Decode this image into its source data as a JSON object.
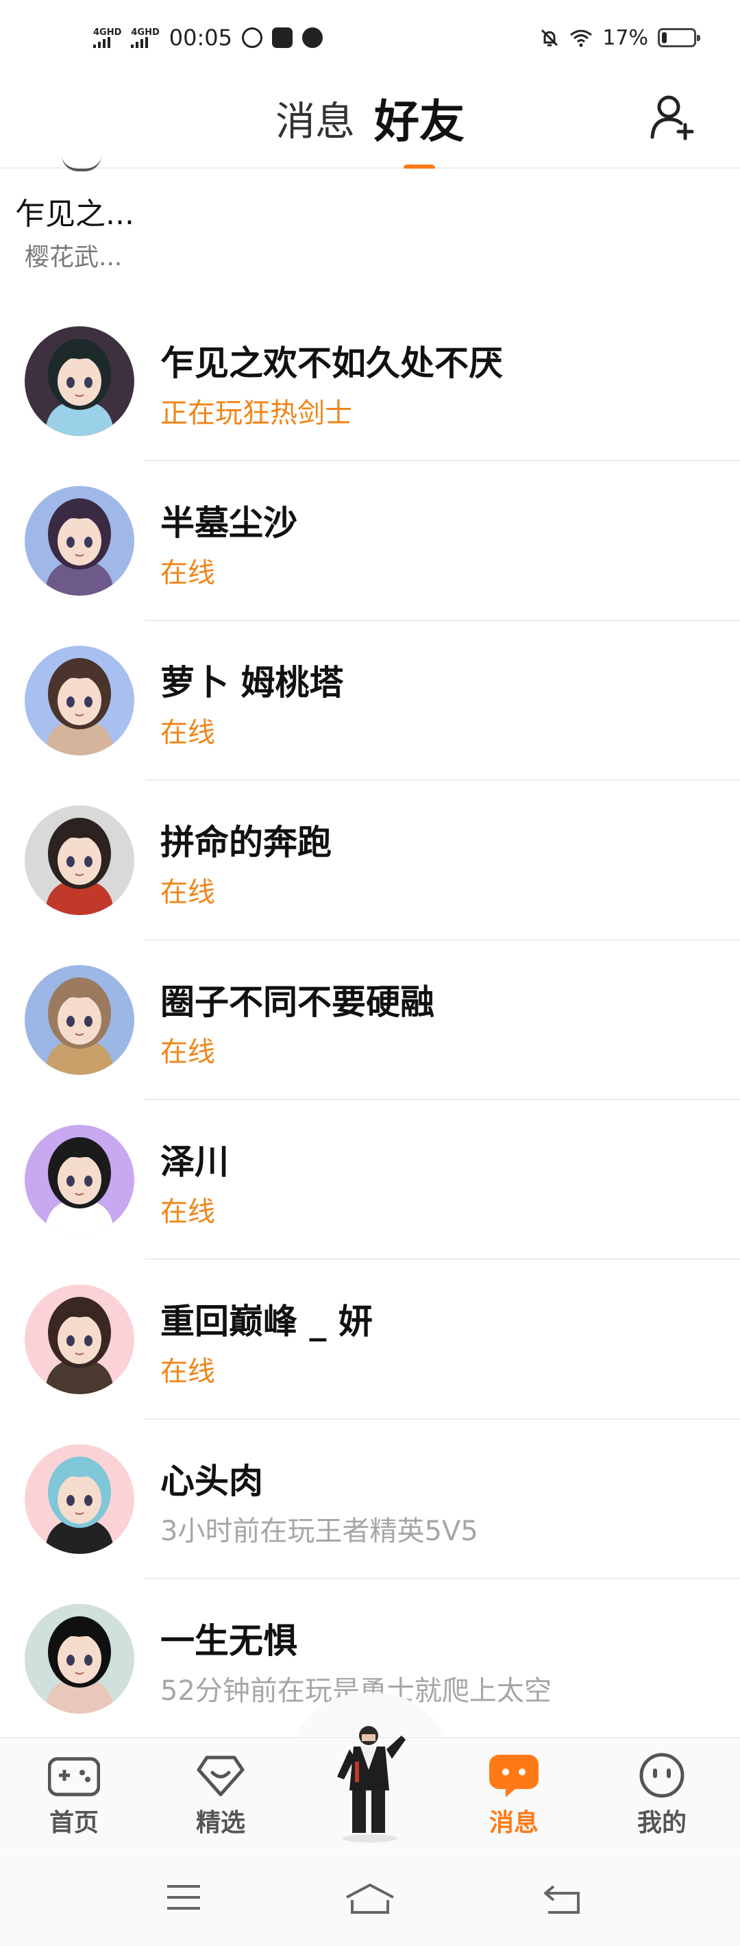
{
  "status_bar": {
    "signal1": "4GHD",
    "signal2": "4GHD",
    "time": "00:05",
    "battery": "17%",
    "battery_level": 0.17
  },
  "header": {
    "tabs": [
      {
        "label": "消息",
        "active": false
      },
      {
        "label": "好友",
        "active": true
      }
    ]
  },
  "pinned": {
    "name": "乍见之...",
    "sub": "樱花武..."
  },
  "friends": [
    {
      "name": "乍见之欢不如久处不厌",
      "status": "正在玩狂热剑士",
      "status_type": "online",
      "avatar_bg": "#3d3140",
      "hair": "#1e2a2a",
      "accent": "#9ad1e8"
    },
    {
      "name": "半墓尘沙",
      "status": "在线",
      "status_type": "online",
      "avatar_bg": "#9fb8e8",
      "hair": "#3a2a44",
      "accent": "#6d5a8a"
    },
    {
      "name": "萝卜 姆桃塔",
      "status": "在线",
      "status_type": "online",
      "avatar_bg": "#a8c0ef",
      "hair": "#4a342c",
      "accent": "#d4b49a"
    },
    {
      "name": "拼命的奔跑",
      "status": "在线",
      "status_type": "online",
      "avatar_bg": "#d9d9d9",
      "hair": "#2c2220",
      "accent": "#c0392b"
    },
    {
      "name": "圈子不同不要硬融",
      "status": "在线",
      "status_type": "online",
      "avatar_bg": "#9cb6e6",
      "hair": "#9b7a5e",
      "accent": "#c9a06a"
    },
    {
      "name": "泽川",
      "status": "在线",
      "status_type": "online",
      "avatar_bg": "#c8a8f0",
      "hair": "#1b1b1b",
      "accent": "#ffffff"
    },
    {
      "name": "重回巅峰 _ 妍",
      "status": "在线",
      "status_type": "online",
      "avatar_bg": "#fbd2d8",
      "hair": "#3a2622",
      "accent": "#4a3a30"
    },
    {
      "name": "心头肉",
      "status": "3小时前在玩王者精英5V5",
      "status_type": "offline",
      "avatar_bg": "#fbd3d6",
      "hair": "#7fc7d9",
      "accent": "#222222"
    },
    {
      "name": "一生无惧",
      "status": "52分钟前在玩是勇士就爬上太空",
      "status_type": "offline",
      "avatar_bg": "#cfe0dd",
      "hair": "#101010",
      "accent": "#e8c8b8"
    }
  ],
  "bottom_nav": {
    "items": [
      {
        "label": "首页",
        "icon": "gamepad-icon",
        "active": false
      },
      {
        "label": "精选",
        "icon": "heart-diamond-icon",
        "active": false
      },
      {
        "label": "消息",
        "icon": "chat-bubble-icon",
        "active": true
      },
      {
        "label": "我的",
        "icon": "smiley-icon",
        "active": false
      }
    ]
  },
  "colors": {
    "accent": "#ff7a17",
    "online": "#f08519",
    "offline": "#a6a6a6"
  }
}
